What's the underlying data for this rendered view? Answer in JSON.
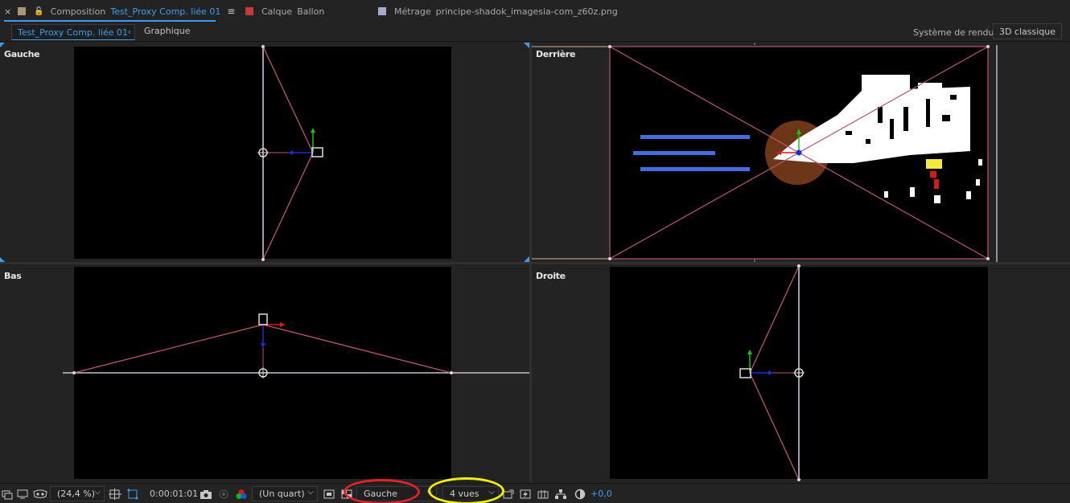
{
  "tabs": [
    {
      "label": "Composition",
      "value": "Test_Proxy Comp. liée 01",
      "swatch": "#a89476",
      "active": true
    },
    {
      "label": "Calque",
      "value": "Ballon",
      "swatch": "#c43a3a",
      "active": false
    },
    {
      "label": "Métrage",
      "value": "principe-shadok_imagesia-com_z60z.png",
      "swatch": "#a9a9c9",
      "active": false
    }
  ],
  "breadcrumb": {
    "current": "Test_Proxy Comp. liée 01",
    "next": "Graphique"
  },
  "renderer": {
    "label": "Système de rendu :",
    "value": "3D classique"
  },
  "views": {
    "top_left": "Gauche",
    "top_right": "Derrière",
    "bottom_left": "Bas",
    "bottom_right": "Droite"
  },
  "toolbar": {
    "zoom": "(24,4 %)",
    "timecode": "0:00:01:01",
    "resolution": "(Un quart)",
    "active_view": "Gauche",
    "layout": "4 vues",
    "exposure": "+0,0"
  },
  "colors": {
    "accent": "#3d9cf0",
    "highlight_active_view": "#e0212a",
    "highlight_layout": "#f3ec13",
    "camera_lines": "#b9566a",
    "axis_x": "#d11a1a",
    "axis_y": "#18c21c",
    "axis_z": "#1a2fd1"
  }
}
